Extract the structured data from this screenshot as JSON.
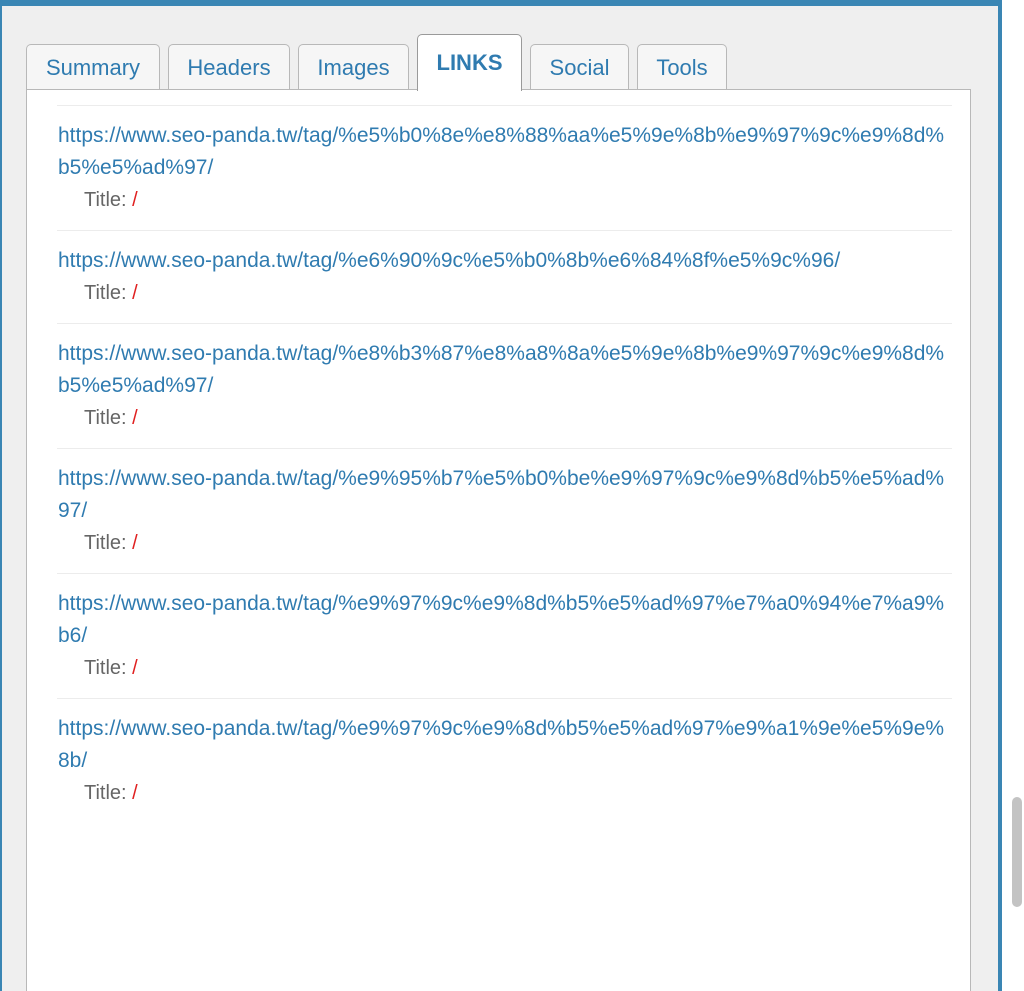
{
  "tabs": [
    {
      "label": "Summary",
      "active": false
    },
    {
      "label": "Headers",
      "active": false
    },
    {
      "label": "Images",
      "active": false
    },
    {
      "label": "LINKS",
      "active": true
    },
    {
      "label": "Social",
      "active": false
    },
    {
      "label": "Tools",
      "active": false
    }
  ],
  "links": [
    {
      "url": "https://www.seo-panda.tw/tag/%e5%b0%8e%e8%88%aa%e5%9e%8b%e9%97%9c%e9%8d%b5%e5%ad%97/",
      "title_label": "Title:",
      "title_value": "/"
    },
    {
      "url": "https://www.seo-panda.tw/tag/%e6%90%9c%e5%b0%8b%e6%84%8f%e5%9c%96/",
      "title_label": "Title:",
      "title_value": "/"
    },
    {
      "url": "https://www.seo-panda.tw/tag/%e8%b3%87%e8%a8%8a%e5%9e%8b%e9%97%9c%e9%8d%b5%e5%ad%97/",
      "title_label": "Title:",
      "title_value": "/"
    },
    {
      "url": "https://www.seo-panda.tw/tag/%e9%95%b7%e5%b0%be%e9%97%9c%e9%8d%b5%e5%ad%97/",
      "title_label": "Title:",
      "title_value": "/"
    },
    {
      "url": "https://www.seo-panda.tw/tag/%e9%97%9c%e9%8d%b5%e5%ad%97%e7%a0%94%e7%a9%b6/",
      "title_label": "Title:",
      "title_value": "/"
    },
    {
      "url": "https://www.seo-panda.tw/tag/%e9%97%9c%e9%8d%b5%e5%ad%97%e9%a1%9e%e5%9e%8b/",
      "title_label": "Title:",
      "title_value": "/"
    }
  ],
  "colors": {
    "frame": "#3a86b4",
    "link": "#2f7bb0",
    "title_value": "#e02020"
  }
}
